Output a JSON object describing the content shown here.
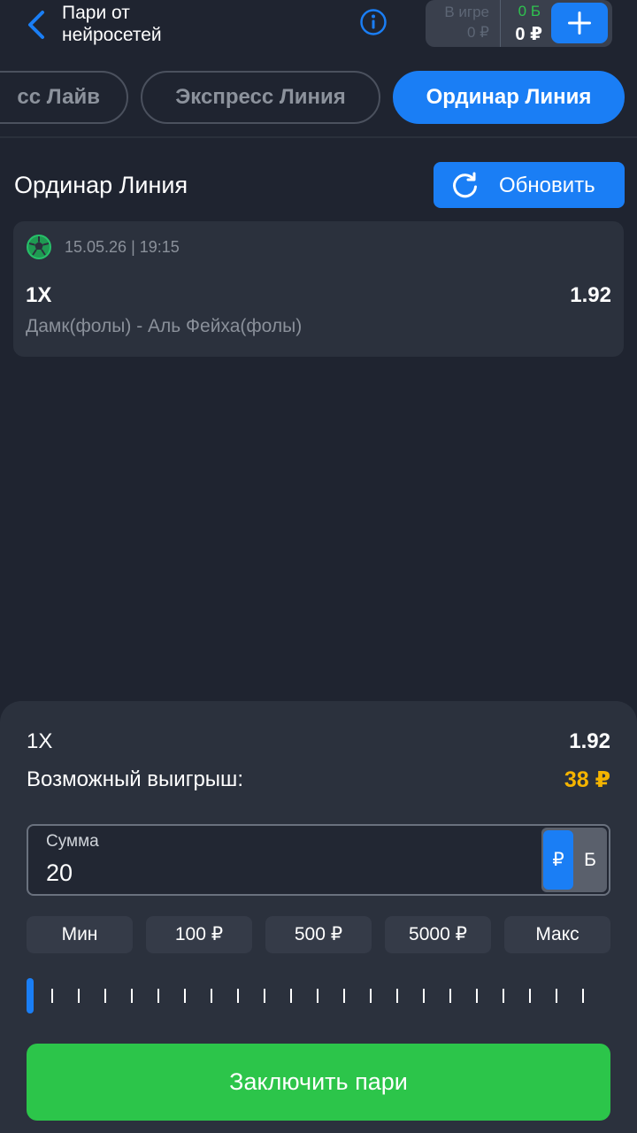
{
  "header": {
    "title_line1": "Пари от",
    "title_line2": "нейросетей",
    "balance": {
      "in_game_label": "В игре",
      "in_game_value": "0 ₽",
      "bonus_value": "0 Б",
      "rub_value": "0 ₽"
    }
  },
  "tabs": [
    {
      "label": "сс Лайв",
      "active": false
    },
    {
      "label": "Экспресс Линия",
      "active": false
    },
    {
      "label": "Ординар Линия",
      "active": true
    }
  ],
  "section": {
    "title": "Ординар Линия",
    "refresh_label": "Обновить"
  },
  "bet_card": {
    "sport_icon": "soccer-ball-icon",
    "datetime": "15.05.26 | 19:15",
    "outcome": "1X",
    "odds": "1.92",
    "match": "Дамк(фолы) - Аль Фейха(фолы)"
  },
  "bet_slip": {
    "outcome": "1X",
    "odds": "1.92",
    "possible_win_label": "Возможный выигрыш:",
    "possible_win_value": "38 ₽",
    "amount_label": "Сумма",
    "amount_value": "20",
    "currency_rub": "₽",
    "currency_bonus": "Б",
    "presets": [
      "Мин",
      "100 ₽",
      "500 ₽",
      "5000 ₽",
      "Макс"
    ],
    "slider_level": 0,
    "submit_label": "Заключить пари"
  },
  "colors": {
    "accent": "#1a7ef5",
    "success": "#2cc54a",
    "win": "#f5b400",
    "background": "#1f2430",
    "card": "#2b313d"
  }
}
